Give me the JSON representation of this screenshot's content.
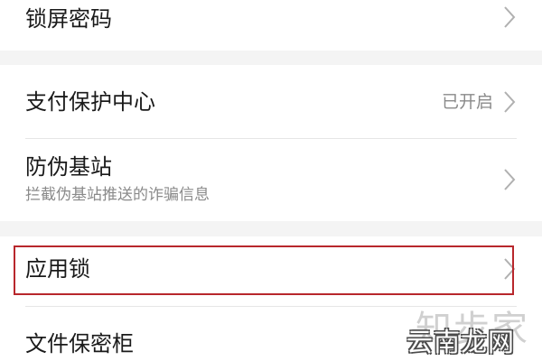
{
  "settings": {
    "group1": {
      "lock_screen_password": {
        "title": "锁屏密码"
      }
    },
    "group2": {
      "payment_protection": {
        "title": "支付保护中心",
        "value": "已开启"
      },
      "anti_fake_station": {
        "title": "防伪基站",
        "subtitle": "拦截伪基站推送的诈骗信息"
      }
    },
    "group3": {
      "app_lock": {
        "title": "应用锁"
      },
      "file_safe": {
        "title": "文件保密柜"
      }
    }
  },
  "watermark": {
    "top_text": "知步家",
    "text": "云南龙网"
  },
  "colors": {
    "highlight_border": "#b8272c",
    "section_gap": "#f4f4f4",
    "row_background": "#ffffff"
  },
  "icons": {
    "chevron": "chevron-right-icon"
  }
}
